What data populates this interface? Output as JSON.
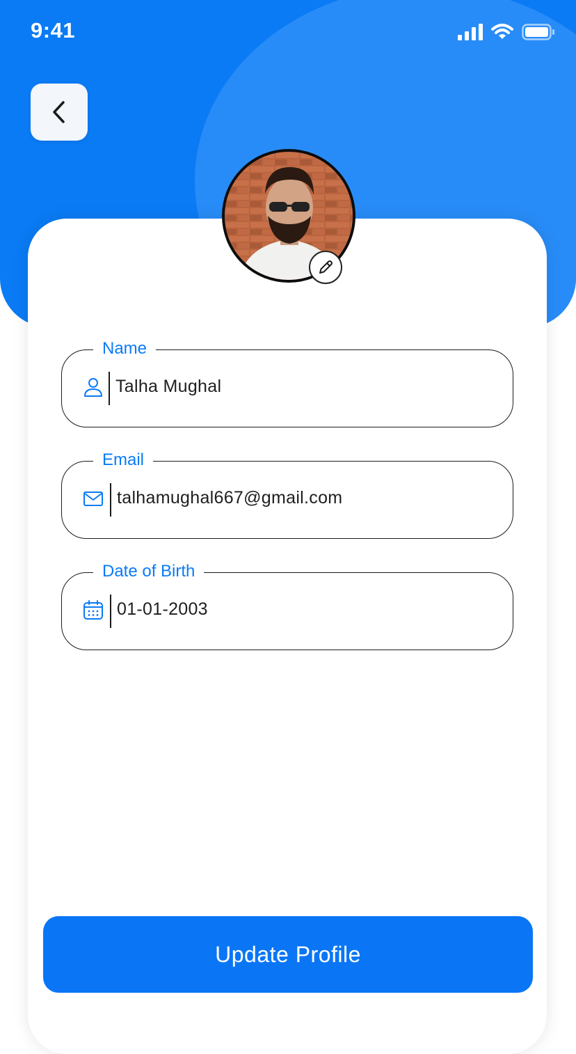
{
  "status_bar": {
    "time": "9:41",
    "icons": [
      "signal-icon",
      "wifi-icon",
      "battery-icon"
    ]
  },
  "header": {
    "back_icon": "chevron-left-icon"
  },
  "profile": {
    "edit_icon": "pencil-icon"
  },
  "form": {
    "fields": [
      {
        "label": "Name",
        "value": "Talha Mughal",
        "icon": "user-icon"
      },
      {
        "label": "Email",
        "value": "talhamughal667@gmail.com",
        "icon": "mail-icon"
      },
      {
        "label": "Date of Birth",
        "value": "01-01-2003",
        "icon": "calendar-icon"
      }
    ]
  },
  "actions": {
    "update_label": "Update Profile"
  },
  "colors": {
    "primary": "#0a7bf5",
    "header_circle": "#2b8ef8",
    "text": "#1e1e1e"
  }
}
